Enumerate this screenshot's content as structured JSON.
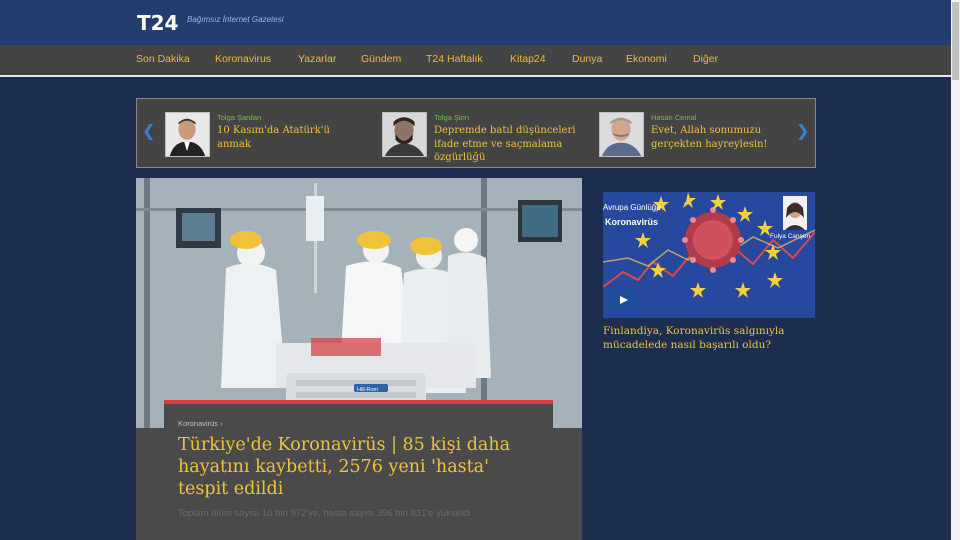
{
  "header": {
    "logo": "T24",
    "tagline": "Bağımsız İnternet Gazetesi"
  },
  "nav": {
    "items": [
      {
        "label": "Son Dakika"
      },
      {
        "label": "Koronavirus"
      },
      {
        "label": "Yazarlar"
      },
      {
        "label": "Gündem"
      },
      {
        "label": "T24 Haftalık"
      },
      {
        "label": "Kitap24"
      },
      {
        "label": "Dunya"
      },
      {
        "label": "Ekonomi"
      },
      {
        "label": "Diğer"
      }
    ]
  },
  "authors": {
    "prev_icon": "chevron-left-icon",
    "next_icon": "chevron-right-icon",
    "items": [
      {
        "name": "Tolga Şardan",
        "title": "10 Kasım'da Atatürk'ü anmak"
      },
      {
        "name": "Tolga Şirin",
        "title": "Depremde batıl düşünceleri ifade etme ve saçmalama özgürlüğü"
      },
      {
        "name": "Hasan Cemal",
        "title": "Evet, Allah sonumuzu gerçekten hayreylesin!"
      }
    ]
  },
  "main_news": {
    "category": "Koronavirüs ›",
    "headline": "Türkiye'de Koronavirüs | 85 kişi daha hayatını kaybetti, 2576 yeni 'hasta' tespit edildi",
    "summary": "Toplam ölüm sayısı 10 bin 972'ye, hasta sayısı 396 bin 831'e yükseldi",
    "photo_text": "Hill-Rom"
  },
  "side_video": {
    "label": "Avrupa Günlüğü",
    "topic": "Koronavirüs",
    "person": "Fulya Canşen",
    "play_icon": "play-icon",
    "title": "Finlandiya, Koronavirüs salgınıyla mücadelede nasıl başarılı oldu?"
  },
  "colors": {
    "page_bg": "#1c2d4f",
    "header_bg": "#233e6e",
    "nav_bg": "#444444",
    "accent_gold": "#f0c23a",
    "author_green": "#6fbf3b",
    "highlight_red": "#e23a3a"
  }
}
